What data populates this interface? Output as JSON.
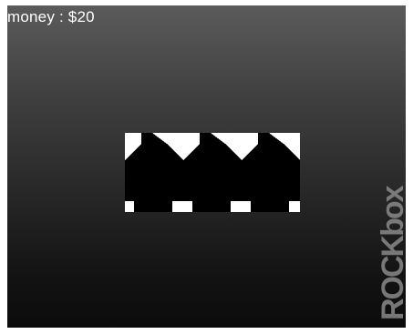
{
  "hud": {
    "money_text": "money : $20"
  },
  "slot_machine": {
    "reels": [
      {
        "symbol": "cherry-icon"
      },
      {
        "symbol": "cherry-icon"
      },
      {
        "symbol": "cherry-icon"
      }
    ]
  },
  "branding": {
    "logo_name": "rockbox-logo",
    "logo_text": "ROCKbox"
  },
  "colors": {
    "background_top": "#5b5b5b",
    "background_bottom": "#0c0c0c",
    "text": "#ffffff",
    "symbol_fg": "#000000",
    "symbol_bg": "#ffffff"
  }
}
